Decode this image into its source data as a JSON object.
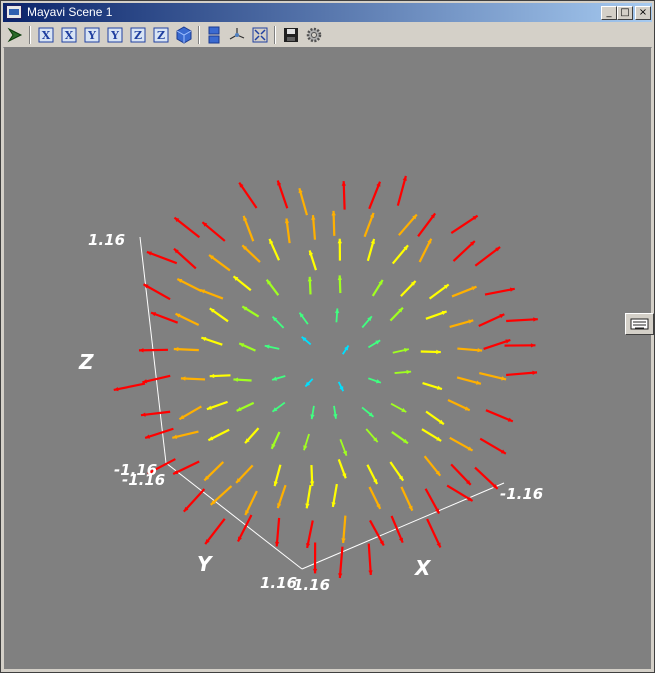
{
  "window": {
    "title": "Mayavi Scene 1",
    "controls": {
      "minimize": "_",
      "maximize": "□",
      "close": "×"
    }
  },
  "toolbar": {
    "items": [
      {
        "name": "mayavi-pipeline-icon"
      },
      {
        "name": "view-x-plus-icon",
        "glyph": "X"
      },
      {
        "name": "view-x-minus-icon",
        "glyph": "X"
      },
      {
        "name": "view-y-plus-icon",
        "glyph": "Y"
      },
      {
        "name": "view-y-minus-icon",
        "glyph": "Y"
      },
      {
        "name": "view-z-plus-icon",
        "glyph": "Z"
      },
      {
        "name": "view-z-minus-icon",
        "glyph": "Z"
      },
      {
        "name": "isometric-view-icon"
      },
      {
        "name": "parallel-projection-icon"
      },
      {
        "name": "axes-indicator-icon"
      },
      {
        "name": "full-screen-icon"
      },
      {
        "name": "save-icon"
      },
      {
        "name": "configure-icon"
      }
    ]
  },
  "scene": {
    "axis_labels": {
      "x": "X",
      "y": "Y",
      "z": "Z"
    },
    "tick_labels": {
      "z_top": "1.16",
      "z_bottom": "-1.16",
      "y_back": "-1.16",
      "y_front": "1.16",
      "x_front": "1.16",
      "x_right": "-1.16"
    },
    "colormap": [
      "#00e0ff",
      "#40ff80",
      "#a0ff20",
      "#ffff00",
      "#ffb000",
      "#ff0000"
    ],
    "background": "#808080",
    "field": "radial outward vector field shown as colored arrows"
  }
}
